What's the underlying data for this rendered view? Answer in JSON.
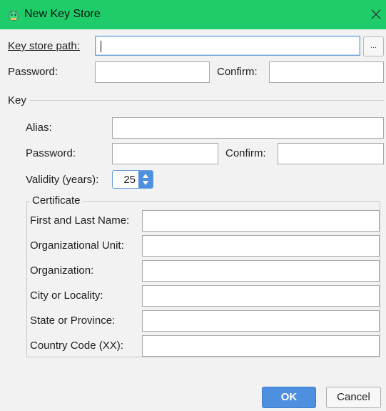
{
  "window": {
    "title": "New Key Store",
    "app_icon": "android-icon",
    "close_icon": "close-icon"
  },
  "keystore": {
    "path_label": "Key store path:",
    "path_value": "",
    "browse_label": "...",
    "password_label": "Password:",
    "password_value": "",
    "confirm_label": "Confirm:",
    "confirm_value": ""
  },
  "key": {
    "section_label": "Key",
    "alias_label": "Alias:",
    "alias_value": "",
    "password_label": "Password:",
    "password_value": "",
    "confirm_label": "Confirm:",
    "confirm_value": "",
    "validity_label": "Validity (years):",
    "validity_value": "25"
  },
  "certificate": {
    "group_label": "Certificate",
    "fields": [
      {
        "label": "First and Last Name:",
        "value": ""
      },
      {
        "label": "Organizational Unit:",
        "value": ""
      },
      {
        "label": "Organization:",
        "value": ""
      },
      {
        "label": "City or Locality:",
        "value": ""
      },
      {
        "label": "State or Province:",
        "value": ""
      },
      {
        "label": "Country Code (XX):",
        "value": ""
      }
    ]
  },
  "buttons": {
    "ok_label": "OK",
    "cancel_label": "Cancel"
  },
  "colors": {
    "titlebar": "#1ecd6a",
    "accent": "#4f8fe0"
  }
}
